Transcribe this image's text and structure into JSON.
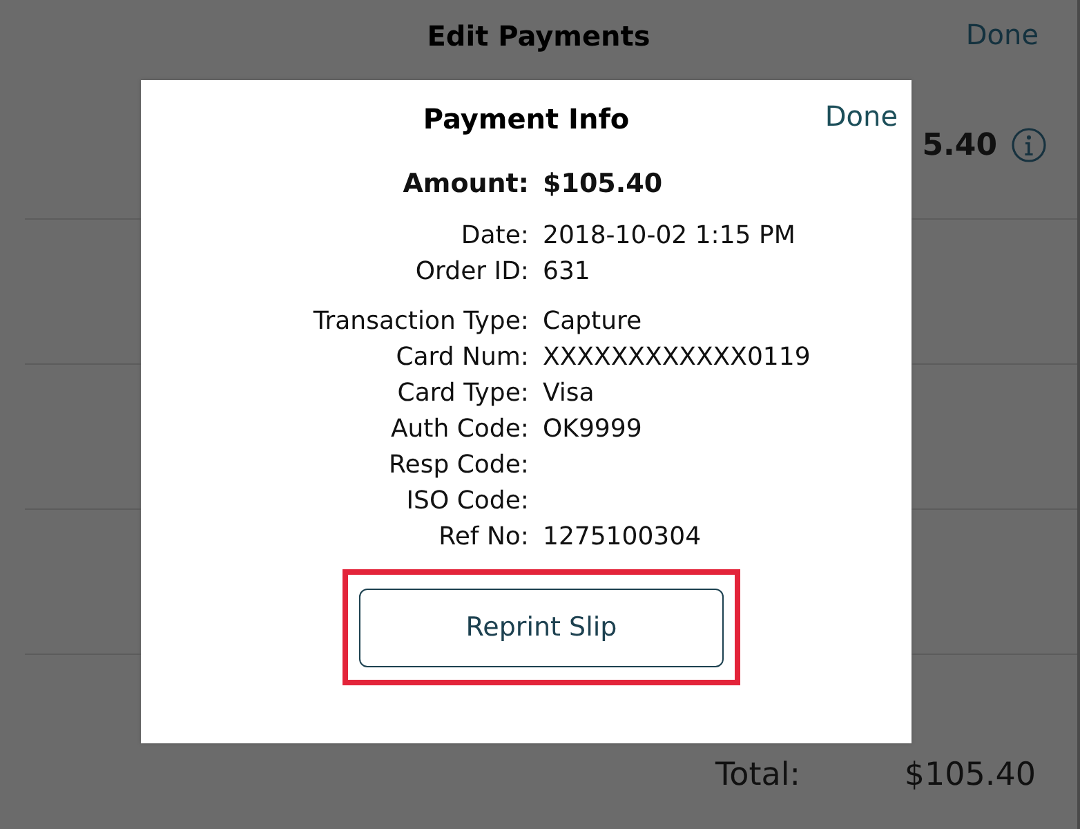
{
  "screen": {
    "title": "Edit Payments",
    "done": "Done",
    "payment_amount": "5.40",
    "total_label": "Total:",
    "total_value": "$105.40"
  },
  "dialog": {
    "title": "Payment Info",
    "done": "Done",
    "sections": [
      {
        "fields": [
          {
            "kind": "emphasis",
            "label": "Amount:",
            "value": "$105.40"
          }
        ]
      },
      {
        "fields": [
          {
            "kind": "plain",
            "label": "Date:",
            "value": "2018-10-02 1:15 PM"
          },
          {
            "kind": "plain",
            "label": "Order ID:",
            "value": "631"
          }
        ]
      },
      {
        "fields": [
          {
            "kind": "plain",
            "label": "Transaction Type:",
            "value": "Capture"
          },
          {
            "kind": "plain",
            "label": "Card Num:",
            "value": "XXXXXXXXXXXX0119"
          },
          {
            "kind": "plain",
            "label": "Card Type:",
            "value": "Visa"
          },
          {
            "kind": "plain",
            "label": "Auth Code:",
            "value": "OK9999"
          },
          {
            "kind": "plain",
            "label": "Resp Code:"
          },
          {
            "kind": "plain",
            "label": "ISO Code:"
          },
          {
            "kind": "plain",
            "label": "Ref No:",
            "value": "1275100304"
          }
        ]
      }
    ],
    "button": {
      "label": "Reprint Slip",
      "highlighted": true
    }
  }
}
